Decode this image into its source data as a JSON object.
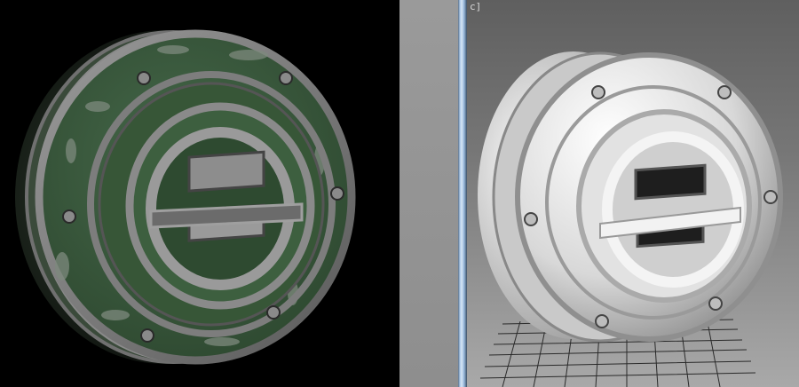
{
  "viewport": {
    "label": "c]",
    "render_mode": "shaded-clay",
    "grid_visible": true
  },
  "render": {
    "render_mode": "textured",
    "paint_color": "#3c5e3c",
    "metal_color": "#8c8c8c"
  },
  "colors": {
    "background_render": "#000000",
    "background_viewport": "#777777",
    "divider_accent": "#a9c6e6"
  }
}
